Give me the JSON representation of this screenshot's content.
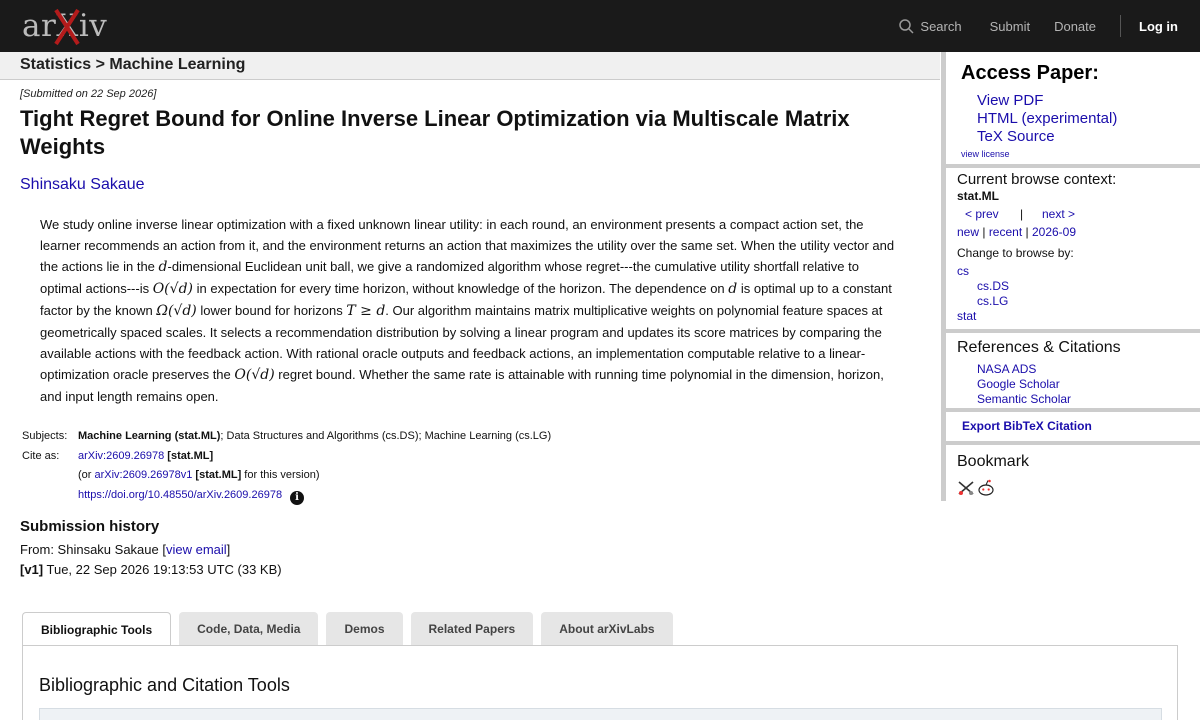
{
  "header": {
    "logo_text": "arXiv",
    "nav": {
      "search": "Search",
      "submit": "Submit",
      "donate": "Donate",
      "login": "Log in"
    }
  },
  "breadcrumb": {
    "text": "Statistics > Machine Learning"
  },
  "paper": {
    "submitted": "[Submitted on 22 Sep 2026]",
    "title": "Tight Regret Bound for Online Inverse Linear Optimization via Multiscale Matrix Weights",
    "author": "Shinsaku Sakaue",
    "abstract": {
      "p1": "We study online inverse linear optimization with a fixed unknown linear utility: in each round, an environment presents a compact action set, the learner recommends an action from it, and the environment returns an action that maximizes the utility over the same set. When the utility vector and the actions lie in the ",
      "m1": "d",
      "p2": "-dimensional Euclidean unit ball, we give a randomized algorithm whose regret---the cumulative utility shortfall relative to optimal actions---is ",
      "m2": "O(√d)",
      "p3": " in expectation for every time horizon, without knowledge of the horizon. The dependence on ",
      "m3": "d",
      "p4": " is optimal up to a constant factor by the known ",
      "m4": "Ω(√d)",
      "p5": " lower bound for horizons ",
      "m5": "T ≥ d",
      "p6": ". Our algorithm maintains matrix multiplicative weights on polynomial feature spaces at geometrically spaced scales. It selects a recommendation distribution by solving a linear program and updates its score matrices by comparing the available actions with the feedback action. With rational oracle outputs and feedback actions, an implementation computable relative to a linear-optimization oracle preserves the ",
      "m6": "O(√d)",
      "p7": " regret bound. Whether the same rate is attainable with running time polynomial in the dimension, horizon, and input length remains open."
    },
    "meta": {
      "subjects_label": "Subjects:",
      "subjects_primary": "Machine Learning (stat.ML)",
      "subjects_rest": "; Data Structures and Algorithms (cs.DS); Machine Learning (cs.LG)",
      "cite_label": "Cite as:",
      "cite_id": "arXiv:2609.26978",
      "cite_tag": "[stat.ML]",
      "version_pre": "(or ",
      "version_id": "arXiv:2609.26978v1",
      "version_tag": "[stat.ML]",
      "version_post": " for this version)",
      "doi": "https://doi.org/10.48550/arXiv.2609.26978",
      "info_glyph": "i"
    },
    "history": {
      "title": "Submission history",
      "from_pre": "From: Shinsaku Sakaue [",
      "view_email": "view email",
      "from_post": "]",
      "v1_label": "[v1]",
      "v1_text": " Tue, 22 Sep 2026 19:13:53 UTC (33 KB)"
    }
  },
  "tabs": {
    "items": [
      "Bibliographic Tools",
      "Code, Data, Media",
      "Demos",
      "Related Papers",
      "About arXivLabs"
    ],
    "active": "Bibliographic Tools",
    "panel_title": "Bibliographic and Citation Tools"
  },
  "sidebar": {
    "access": {
      "title": "Access Paper:",
      "links": [
        "View PDF",
        "HTML (experimental)",
        "TeX Source"
      ],
      "license": "view license"
    },
    "browse": {
      "title": "Current browse context:",
      "context": "stat.ML",
      "prev": "< prev",
      "sep": "|",
      "next": "next >",
      "new": "new",
      "recent": "recent",
      "date": "2026-09",
      "pipe": " | ",
      "change_label": "Change to browse by:",
      "cats": [
        "cs",
        "cs.DS",
        "cs.LG",
        "stat"
      ]
    },
    "refs": {
      "title": "References & Citations",
      "links": [
        "NASA ADS",
        "Google Scholar",
        "Semantic Scholar"
      ]
    },
    "export": "Export BibTeX Citation",
    "bookmark": {
      "title": "Bookmark",
      "icons": [
        "bibsonomy-icon",
        "reddit-icon"
      ]
    }
  },
  "colors": {
    "topbar": "#1a1a1a",
    "link": "#1a0dab",
    "logo_x": "#b31b1b"
  }
}
